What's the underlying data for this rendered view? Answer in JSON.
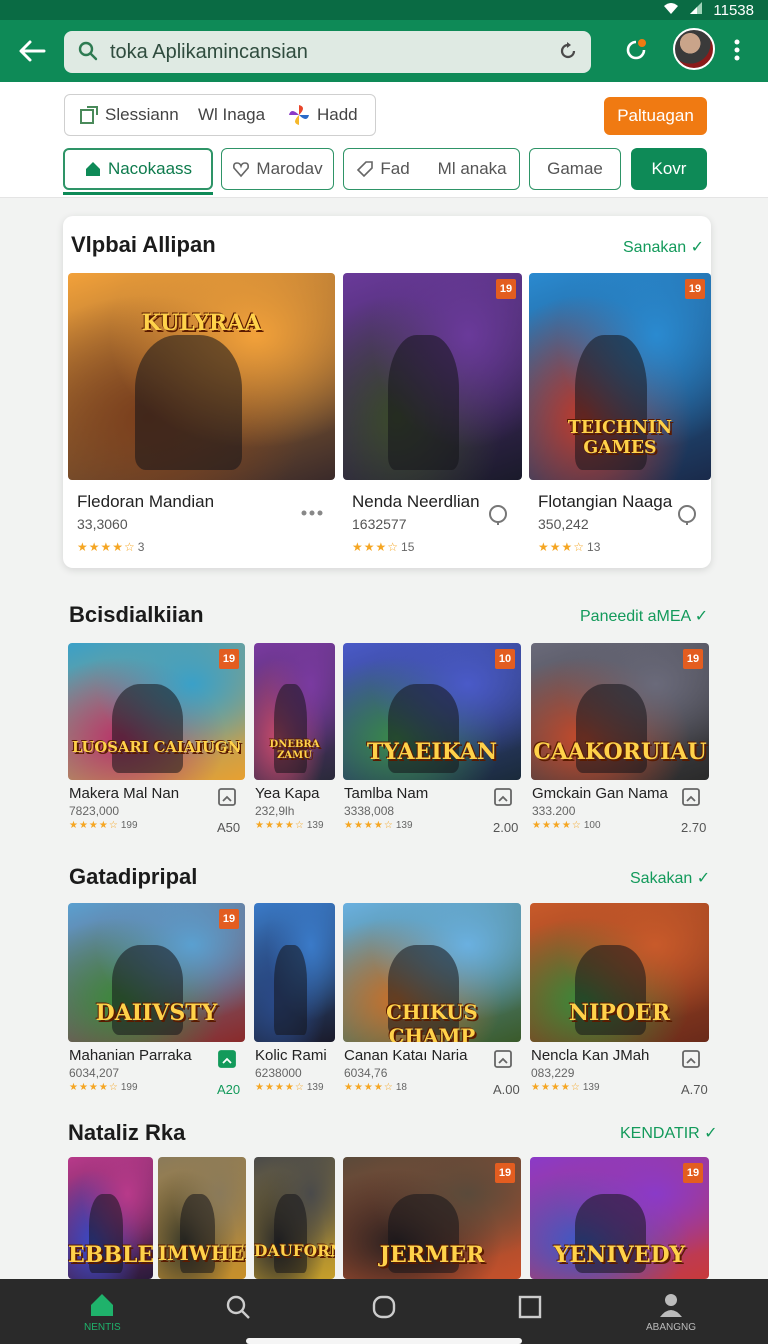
{
  "status": {
    "time": "11538"
  },
  "search": {
    "value": "toka Aplikamincansian"
  },
  "filters": {
    "segments": [
      "Slessiann",
      "Wl Inaga",
      "Hadd"
    ],
    "action_label": "Paltuagan",
    "chips": [
      "Nacokaass",
      "Marodav",
      "Fad",
      "Ml anaka",
      "Gamae",
      "Kovr"
    ]
  },
  "sections": [
    {
      "title": "Vlpbai Allipan",
      "link": "Sanakan",
      "items": [
        {
          "name": "Fledoran Mandian",
          "count": "33,3060",
          "rating": "3",
          "logo": "KULYRAA",
          "tag": "",
          "colors": [
            "#f2a13a",
            "#7a3e1c",
            "#3a2a2a"
          ]
        },
        {
          "name": "Nenda Neerdlian",
          "count": "1632577",
          "rating": "15",
          "logo": "",
          "tag": "19",
          "colors": [
            "#6a3a9a",
            "#3a4a2a",
            "#1a1a2a"
          ]
        },
        {
          "name": "Flotangian Naaga",
          "count": "350,242",
          "rating": "13",
          "logo": "TEICHNIN GAMES",
          "tag": "19",
          "colors": [
            "#2a8ad0",
            "#c03a2a",
            "#1a2a4a"
          ]
        }
      ]
    },
    {
      "title": "Bcisdialkiian",
      "link": "Paneedit aMEA",
      "items": [
        {
          "name": "Makera Mal Nan",
          "count": "7823,000",
          "rating": "199",
          "price": "A50",
          "logo": "LUOSARI CAIAIUGN",
          "tag": "19",
          "colors": [
            "#3aa0c8",
            "#b8326a",
            "#e8a030"
          ]
        },
        {
          "name": "Yea Kapa",
          "count": "232,9lh",
          "rating": "139",
          "price": "",
          "logo": "DNEBRA ZAMU",
          "tag": "",
          "colors": [
            "#7a3aa0",
            "#c84a6a",
            "#2a2a3a"
          ]
        },
        {
          "name": "Tamlba Nam",
          "count": "3338,008",
          "rating": "139",
          "price": "2.00",
          "logo": "TYAEIKAN",
          "tag": "10",
          "colors": [
            "#4a5ac8",
            "#3a8a4a",
            "#1a2a3a"
          ]
        },
        {
          "name": "Gmckain Gan Nama",
          "count": "333.200",
          "rating": "100",
          "price": "2.70",
          "logo": "CAAKORUIAU",
          "tag": "19",
          "colors": [
            "#6a6a7a",
            "#c84a2a",
            "#2a2a2a"
          ]
        }
      ]
    },
    {
      "title": "Gatadipripal",
      "link": "Sakakan",
      "items": [
        {
          "name": "Mahanian Parraka",
          "count": "6034,207",
          "rating": "199",
          "price": "A20",
          "logo": "DAIIVSTY",
          "tag": "19",
          "colors": [
            "#5aa0d0",
            "#3a8a3a",
            "#8a2a2a"
          ]
        },
        {
          "name": "Kolic Rami",
          "count": "6238000",
          "rating": "139",
          "price": "",
          "logo": "",
          "tag": "",
          "colors": [
            "#3a7ac8",
            "#2a4a8a",
            "#1a1a2a"
          ]
        },
        {
          "name": "Canan Kataı Naria",
          "count": "6034,76",
          "rating": "18",
          "price": "A.00",
          "logo": "CHIKUS CHAMP",
          "tag": "",
          "colors": [
            "#6ab0e0",
            "#c8702a",
            "#3a5a2a"
          ]
        },
        {
          "name": "Nencla Kan JMah",
          "count": "083,229",
          "rating": "139",
          "price": "A.70",
          "logo": "NIPOER",
          "tag": "",
          "colors": [
            "#c85a2a",
            "#3a8a3a",
            "#6a2a1a"
          ]
        }
      ]
    },
    {
      "title": "Nataliz Rka",
      "link": "KENDATIR",
      "items": [
        {
          "logo": "EBBLE",
          "tag": "",
          "colors": [
            "#b83a8a",
            "#3a4ac8",
            "#2a1a3a"
          ]
        },
        {
          "logo": "IMWHER",
          "tag": "",
          "colors": [
            "#8a7a5a",
            "#3a3a2a",
            "#c8902a"
          ]
        },
        {
          "logo": "DAUFORN",
          "tag": "",
          "colors": [
            "#4a4a4a",
            "#2a2a2a",
            "#c8a02a"
          ]
        },
        {
          "logo": "JERMER",
          "tag": "19",
          "colors": [
            "#5a4a3a",
            "#2a2020",
            "#c8502a"
          ]
        },
        {
          "logo": "YENIVEDY",
          "tag": "19",
          "colors": [
            "#8a3ac8",
            "#3a5ac8",
            "#c83a3a"
          ]
        }
      ]
    }
  ],
  "nav": {
    "home_label": "NENTIS",
    "profile_label": "ABANGNG"
  }
}
